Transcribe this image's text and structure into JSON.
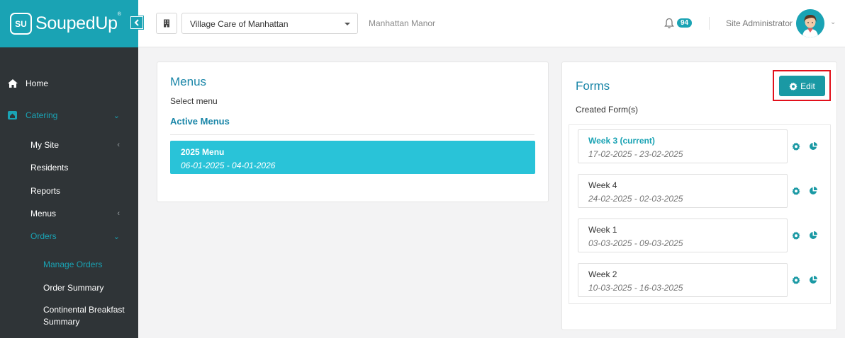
{
  "brand": {
    "logo_text": "SU",
    "name": "SoupedUp",
    "reg": "®"
  },
  "sidebar": {
    "items": [
      {
        "label": "Home",
        "icon": "home-icon"
      },
      {
        "label": "Catering",
        "icon": "catering-icon"
      },
      {
        "label": "My Site"
      },
      {
        "label": "Residents"
      },
      {
        "label": "Reports"
      },
      {
        "label": "Menus"
      },
      {
        "label": "Orders"
      },
      {
        "label": "Manage Orders"
      },
      {
        "label": "Order Summary"
      },
      {
        "label": "Continental Breakfast Summary"
      }
    ]
  },
  "topbar": {
    "site_select": "Village Care of Manhattan",
    "location": "Manhattan Manor",
    "notification_count": "94",
    "user_name": "Site Administrator"
  },
  "menus": {
    "title": "Menus",
    "select_label": "Select menu",
    "active_label": "Active Menus",
    "entries": [
      {
        "name": "2025 Menu",
        "dates": "06-01-2025 - 04-01-2026"
      }
    ]
  },
  "forms": {
    "title": "Forms",
    "edit_label": "Edit",
    "created_label": "Created Form(s)",
    "items": [
      {
        "name": "Week 3 (current)",
        "dates": "17-02-2025 - 23-02-2025"
      },
      {
        "name": "Week 4",
        "dates": "24-02-2025 - 02-03-2025"
      },
      {
        "name": "Week 1",
        "dates": "03-03-2025 - 09-03-2025"
      },
      {
        "name": "Week 2",
        "dates": "10-03-2025 - 16-03-2025"
      }
    ]
  },
  "colors": {
    "accent": "#1aa3b4",
    "sidebar_bg": "#2f3437",
    "highlight": "#e2101b"
  }
}
